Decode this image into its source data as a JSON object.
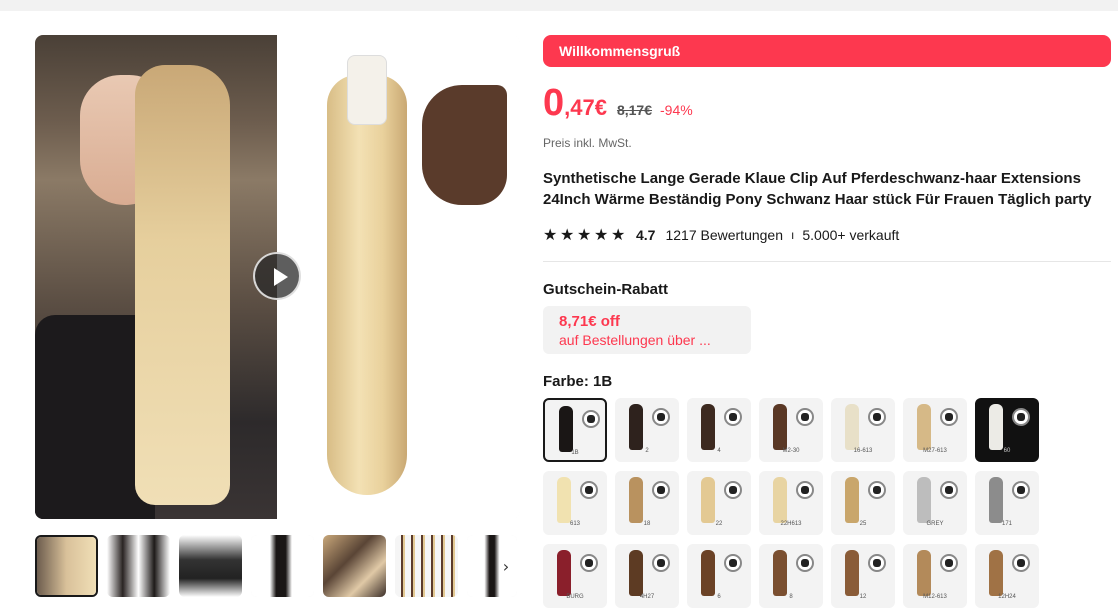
{
  "gallery": {
    "thumbnail_count": 7
  },
  "banner": {
    "welcome": "Willkommensgruß"
  },
  "price": {
    "integer": "0",
    "decimal": ",47€",
    "original": "8,17€",
    "discount": "-94%",
    "tax_note": "Preis inkl. MwSt."
  },
  "product": {
    "title": "Synthetische Lange Gerade Klaue Clip Auf Pferdeschwanz-haar Extensions 24Inch Wärme Beständig Pony Schwanz Haar stück Für Frauen Täglich party",
    "rating": "4.7",
    "reviews": "1217 Bewertungen",
    "separator": "ı",
    "sold": "5.000+ verkauft"
  },
  "coupon": {
    "heading": "Gutschein-Rabatt",
    "amount": "8,71€ off",
    "description": "auf Bestellungen über ..."
  },
  "color": {
    "heading": "Farbe: 1B",
    "options": [
      {
        "label": "1B",
        "hex": "#1a1615"
      },
      {
        "label": "2",
        "hex": "#2e221d"
      },
      {
        "label": "4",
        "hex": "#3d2a20"
      },
      {
        "label": "M2-30",
        "hex": "#5a3825"
      },
      {
        "label": "16-613",
        "hex": "#e8e0c8"
      },
      {
        "label": "M27-613",
        "hex": "#d6b987"
      },
      {
        "label": "60",
        "hex": "#ecebe6"
      },
      {
        "label": "613",
        "hex": "#f1e2b0"
      },
      {
        "label": "18",
        "hex": "#b9925f"
      },
      {
        "label": "22",
        "hex": "#e3c993"
      },
      {
        "label": "22H613",
        "hex": "#e8d4a2"
      },
      {
        "label": "25",
        "hex": "#c9a66b"
      },
      {
        "label": "GREY",
        "hex": "#bdbdbd"
      },
      {
        "label": "171",
        "hex": "#8c8c8c"
      },
      {
        "label": "BURG",
        "hex": "#8a1f2b"
      },
      {
        "label": "4H27",
        "hex": "#5d3b23"
      },
      {
        "label": "6",
        "hex": "#6b4226"
      },
      {
        "label": "8",
        "hex": "#7a4f30"
      },
      {
        "label": "12",
        "hex": "#8a5c38"
      },
      {
        "label": "M12-613",
        "hex": "#b38a5a"
      },
      {
        "label": "12H24",
        "hex": "#a07245"
      }
    ]
  },
  "colors": {
    "accent": "#fd384f",
    "text": "#191919"
  }
}
